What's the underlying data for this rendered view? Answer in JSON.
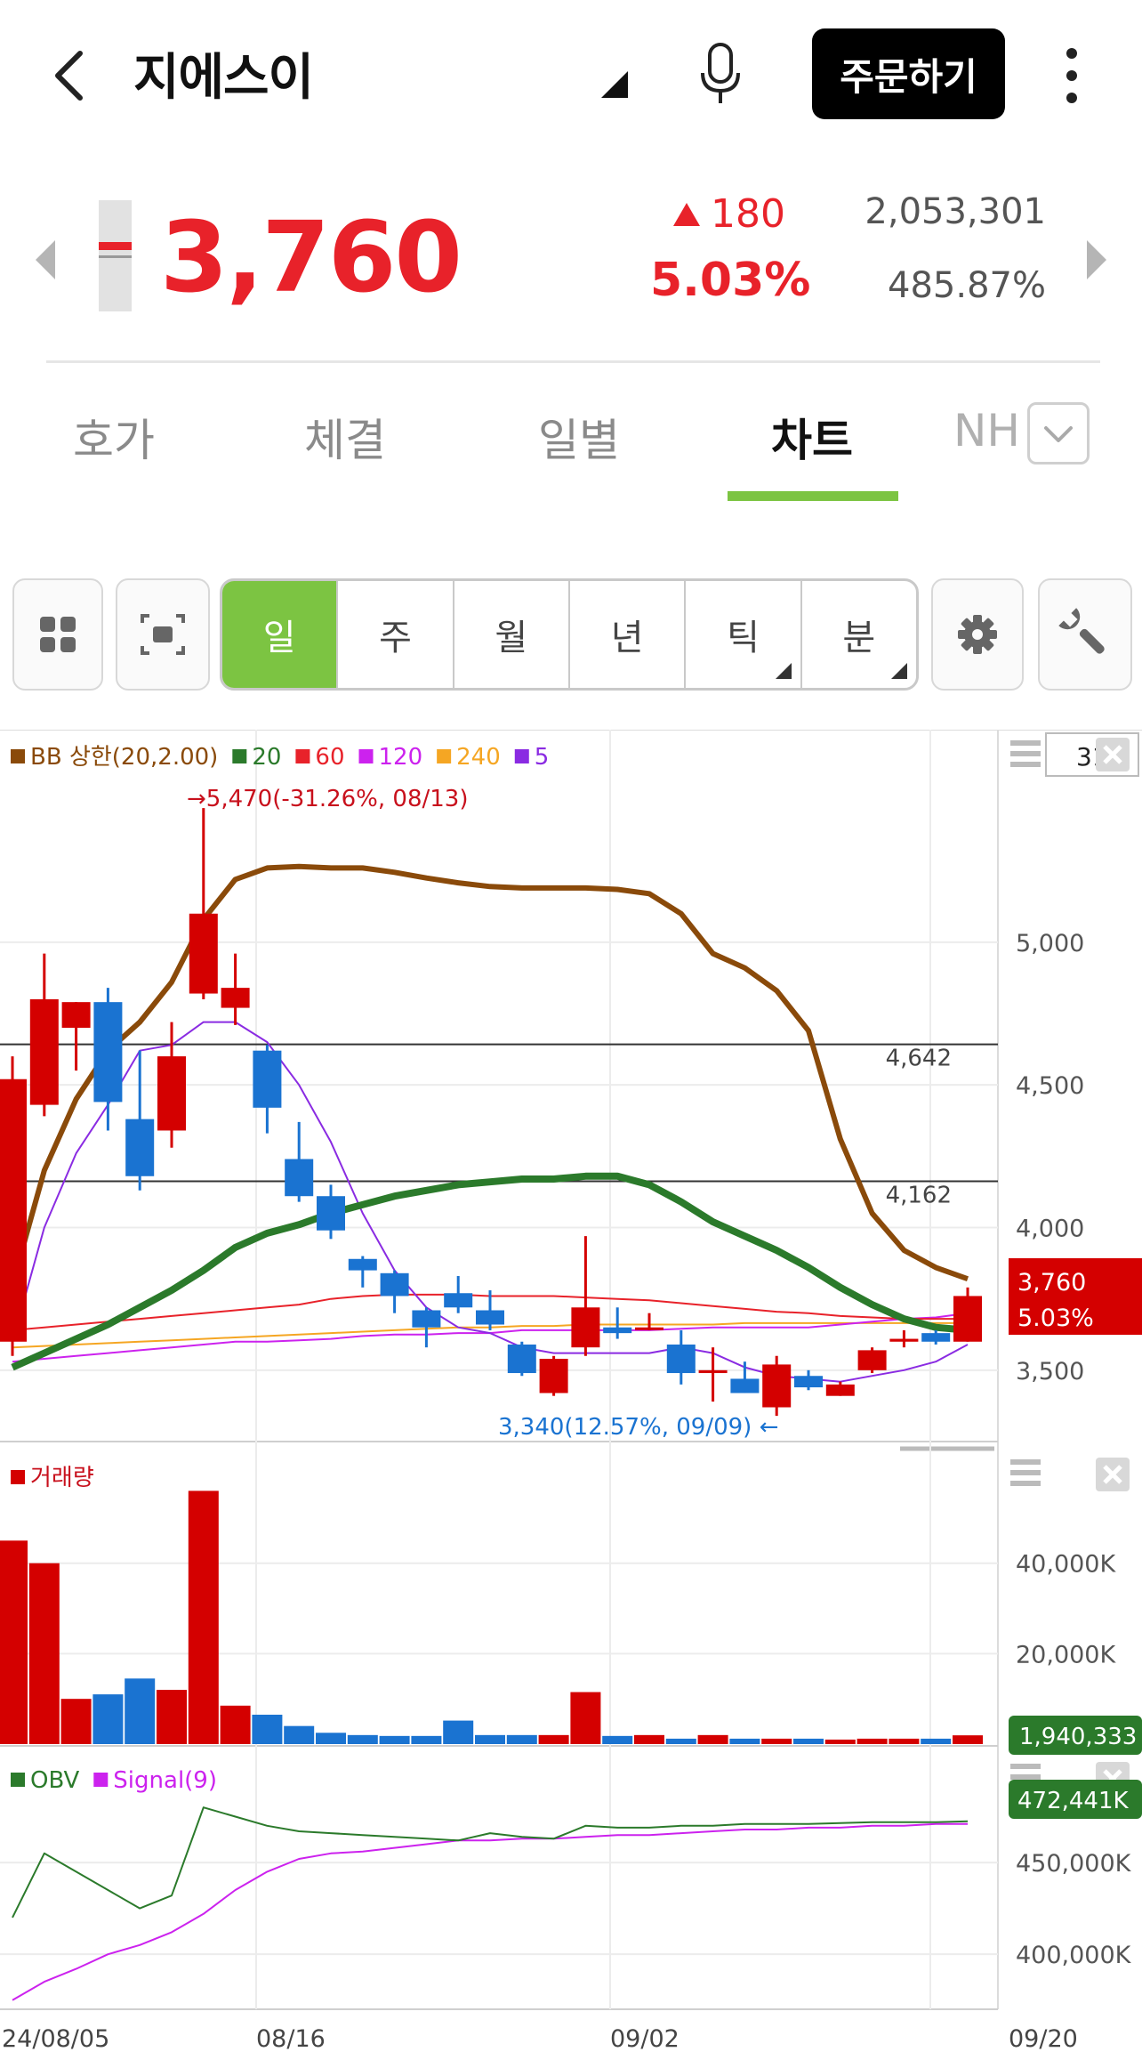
{
  "header": {
    "title": "지에스이",
    "order_label": "주문하기"
  },
  "quote": {
    "price": "3,760",
    "change": "180",
    "change_pct": "5.03%",
    "volume": "2,053,301",
    "volume_pct": "485.87%"
  },
  "tabs": [
    {
      "label": "호가",
      "active": false
    },
    {
      "label": "체결",
      "active": false
    },
    {
      "label": "일별",
      "active": false
    },
    {
      "label": "차트",
      "active": true
    },
    {
      "label": "NH",
      "active": false
    }
  ],
  "periods": [
    {
      "label": "일",
      "active": true
    },
    {
      "label": "주",
      "active": false
    },
    {
      "label": "월",
      "active": false
    },
    {
      "label": "년",
      "active": false
    },
    {
      "label": "틱",
      "active": false,
      "has_menu": true
    },
    {
      "label": "분",
      "active": false,
      "has_menu": true
    }
  ],
  "colors": {
    "up": "#d40000",
    "down": "#1a73d1",
    "accent": "#7cc442",
    "bb": "#8a4a0a",
    "ma20": "#2b7a2b",
    "ma60": "#e8222a",
    "ma120": "#cc22ee",
    "ma240": "#f5a623",
    "ma5": "#8a2be2"
  },
  "chart_data": {
    "type": "candlestick",
    "price_panel": {
      "legend": [
        {
          "label": "BB 상한(20,2.00)",
          "color": "#8a4a0a"
        },
        {
          "label": "20",
          "color": "#2b7a2b"
        },
        {
          "label": "60",
          "color": "#e8222a"
        },
        {
          "label": "120",
          "color": "#cc22ee"
        },
        {
          "label": "240",
          "color": "#f5a623"
        },
        {
          "label": "5",
          "color": "#8a2be2"
        }
      ],
      "count_box": "31",
      "y_ticks": [
        "5,000",
        "4,500",
        "4,000",
        "3,500"
      ],
      "y_tick_values": [
        5000,
        4500,
        4000,
        3500
      ],
      "ylim": [
        3250,
        5620
      ],
      "h_lines": [
        {
          "value": 4642,
          "label": "4,642"
        },
        {
          "value": 4162,
          "label": "4,162"
        }
      ],
      "high_annotation": "5,470(-31.26%, 08/13)",
      "low_annotation": "3,340(12.57%, 09/09)",
      "current_price_label": "3,760",
      "current_pct_label": "5.03%",
      "candles": [
        {
          "o": 3600,
          "h": 4600,
          "l": 3550,
          "c": 4520
        },
        {
          "o": 4430,
          "h": 4960,
          "l": 4390,
          "c": 4800
        },
        {
          "o": 4700,
          "h": 4790,
          "l": 4550,
          "c": 4790
        },
        {
          "o": 4790,
          "h": 4840,
          "l": 4340,
          "c": 4440
        },
        {
          "o": 4380,
          "h": 4620,
          "l": 4130,
          "c": 4180
        },
        {
          "o": 4340,
          "h": 4720,
          "l": 4280,
          "c": 4600
        },
        {
          "o": 4820,
          "h": 5470,
          "l": 4800,
          "c": 5100
        },
        {
          "o": 4770,
          "h": 4960,
          "l": 4710,
          "c": 4840
        },
        {
          "o": 4620,
          "h": 4640,
          "l": 4330,
          "c": 4420
        },
        {
          "o": 4240,
          "h": 4370,
          "l": 4090,
          "c": 4110
        },
        {
          "o": 4110,
          "h": 4150,
          "l": 3960,
          "c": 3990
        },
        {
          "o": 3890,
          "h": 3900,
          "l": 3790,
          "c": 3850
        },
        {
          "o": 3840,
          "h": 3850,
          "l": 3700,
          "c": 3760
        },
        {
          "o": 3710,
          "h": 3720,
          "l": 3580,
          "c": 3650
        },
        {
          "o": 3770,
          "h": 3830,
          "l": 3700,
          "c": 3720
        },
        {
          "o": 3710,
          "h": 3780,
          "l": 3640,
          "c": 3660
        },
        {
          "o": 3590,
          "h": 3600,
          "l": 3480,
          "c": 3490
        },
        {
          "o": 3420,
          "h": 3550,
          "l": 3410,
          "c": 3540
        },
        {
          "o": 3580,
          "h": 3970,
          "l": 3550,
          "c": 3720
        },
        {
          "o": 3650,
          "h": 3720,
          "l": 3610,
          "c": 3630
        },
        {
          "o": 3650,
          "h": 3700,
          "l": 3640,
          "c": 3650
        },
        {
          "o": 3590,
          "h": 3640,
          "l": 3450,
          "c": 3490
        },
        {
          "o": 3490,
          "h": 3580,
          "l": 3390,
          "c": 3500
        },
        {
          "o": 3470,
          "h": 3530,
          "l": 3420,
          "c": 3420
        },
        {
          "o": 3370,
          "h": 3550,
          "l": 3340,
          "c": 3520
        },
        {
          "o": 3480,
          "h": 3500,
          "l": 3430,
          "c": 3440
        },
        {
          "o": 3410,
          "h": 3460,
          "l": 3410,
          "c": 3450
        },
        {
          "o": 3500,
          "h": 3580,
          "l": 3490,
          "c": 3570
        },
        {
          "o": 3600,
          "h": 3640,
          "l": 3580,
          "c": 3610
        },
        {
          "o": 3630,
          "h": 3640,
          "l": 3590,
          "c": 3600
        },
        {
          "o": 3600,
          "h": 3790,
          "l": 3600,
          "c": 3760
        }
      ],
      "bb_upper": [
        3800,
        4200,
        4450,
        4620,
        4720,
        4860,
        5080,
        5220,
        5260,
        5265,
        5260,
        5260,
        5245,
        5225,
        5208,
        5195,
        5190,
        5190,
        5190,
        5185,
        5170,
        5100,
        4960,
        4910,
        4830,
        4690,
        4310,
        4050,
        3920,
        3860,
        3820
      ],
      "ma20": [
        3510,
        3560,
        3610,
        3660,
        3720,
        3780,
        3850,
        3930,
        3980,
        4010,
        4050,
        4080,
        4110,
        4130,
        4150,
        4160,
        4170,
        4170,
        4180,
        4180,
        4150,
        4090,
        4020,
        3970,
        3920,
        3860,
        3790,
        3730,
        3680,
        3650,
        3640
      ],
      "ma60": [
        3640,
        3650,
        3660,
        3670,
        3680,
        3690,
        3700,
        3710,
        3720,
        3730,
        3750,
        3760,
        3765,
        3765,
        3765,
        3760,
        3760,
        3760,
        3755,
        3750,
        3745,
        3735,
        3725,
        3715,
        3705,
        3700,
        3690,
        3685,
        3680,
        3680,
        3680
      ],
      "ma120": [
        3530,
        3540,
        3550,
        3560,
        3570,
        3580,
        3590,
        3600,
        3600,
        3605,
        3610,
        3620,
        3625,
        3625,
        3630,
        3630,
        3640,
        3640,
        3640,
        3640,
        3640,
        3645,
        3650,
        3650,
        3650,
        3650,
        3660,
        3670,
        3680,
        3685,
        3700
      ],
      "ma240": [
        3580,
        3585,
        3590,
        3595,
        3600,
        3605,
        3610,
        3615,
        3620,
        3625,
        3630,
        3635,
        3640,
        3645,
        3650,
        3650,
        3655,
        3655,
        3660,
        3660,
        3660,
        3660,
        3660,
        3665,
        3665,
        3665,
        3665,
        3665,
        3665,
        3665,
        3665
      ],
      "ma5": [
        3600,
        4000,
        4260,
        4430,
        4620,
        4640,
        4720,
        4720,
        4650,
        4500,
        4300,
        4050,
        3850,
        3720,
        3650,
        3630,
        3580,
        3560,
        3560,
        3560,
        3560,
        3580,
        3560,
        3510,
        3480,
        3470,
        3460,
        3480,
        3500,
        3530,
        3590
      ]
    },
    "volume_panel": {
      "legend": "거래량",
      "y_ticks": [
        "40,000K",
        "20,000K"
      ],
      "y_tick_values": [
        40000,
        20000
      ],
      "ylim": [
        0,
        61000
      ],
      "current_label": "1,940,333",
      "values": [
        45000,
        40000,
        10000,
        11000,
        14500,
        12000,
        56000,
        8500,
        6500,
        4000,
        2500,
        2000,
        1800,
        1800,
        5200,
        2000,
        2000,
        2000,
        11500,
        1800,
        2000,
        1200,
        2000,
        1200,
        1200,
        1200,
        1000,
        1200,
        1200,
        1200,
        1940
      ]
    },
    "obv_panel": {
      "legend": [
        {
          "label": "OBV",
          "color": "#2b7a2b"
        },
        {
          "label": "Signal(9)",
          "color": "#cc22ee"
        }
      ],
      "y_ticks": [
        "450,000K",
        "400,000K"
      ],
      "y_tick_values": [
        450000,
        400000
      ],
      "ylim": [
        370000,
        500000
      ],
      "current_label": "472,441K",
      "obv": [
        420000,
        455000,
        445000,
        435000,
        425000,
        432000,
        480000,
        475000,
        470000,
        467000,
        466000,
        465000,
        464000,
        463000,
        462000,
        466000,
        464000,
        463000,
        470000,
        469000,
        469000,
        470000,
        470000,
        471000,
        471000,
        471000,
        471500,
        472000,
        472000,
        472000,
        472441
      ],
      "signal": [
        375000,
        385000,
        392000,
        400000,
        405000,
        412000,
        422000,
        435000,
        445000,
        452000,
        455000,
        456000,
        458000,
        460000,
        462000,
        462000,
        463000,
        463000,
        464000,
        465000,
        465000,
        466000,
        467000,
        468000,
        468000,
        469000,
        469000,
        470000,
        470000,
        471000,
        471000
      ]
    },
    "x_labels": [
      "24/08/05",
      "08/16",
      "09/02",
      "09/20"
    ]
  }
}
